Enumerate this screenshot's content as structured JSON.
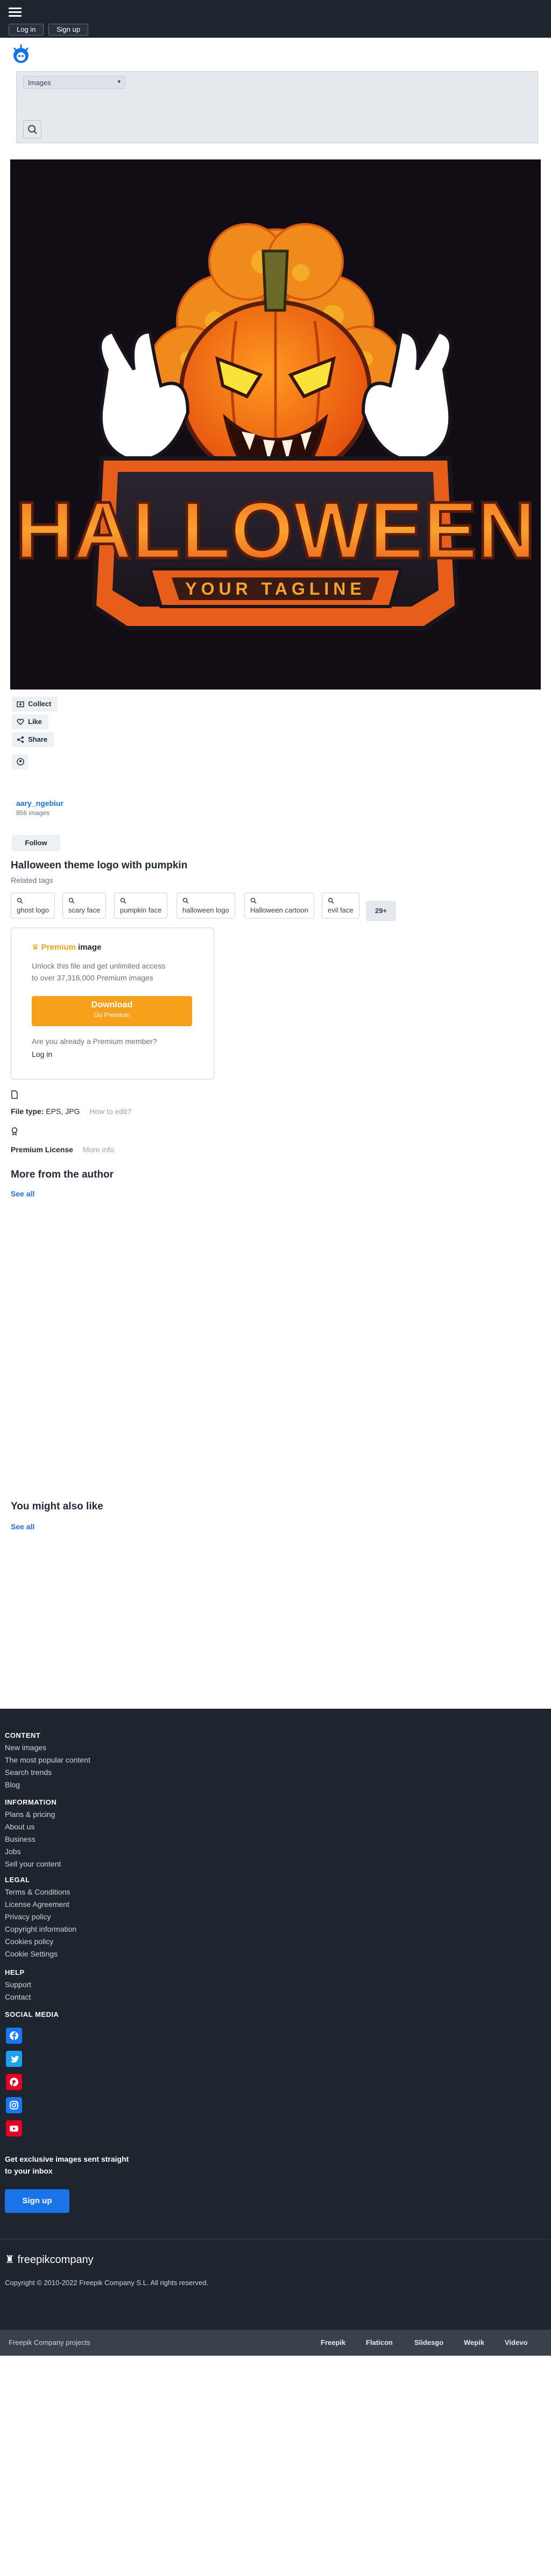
{
  "header": {
    "login_label": "Log in",
    "signup_label": "Sign up"
  },
  "search": {
    "category_selected": "Images"
  },
  "hero": {
    "artwork_title": "HALLOWEEN",
    "artwork_tagline": "YOUR TAGLINE"
  },
  "actions": {
    "collect": "Collect",
    "like": "Like",
    "share": "Share"
  },
  "author": {
    "name": "aary_ngebiur",
    "count": "856 images",
    "follow_label": "Follow"
  },
  "resource": {
    "title": "Halloween theme logo with pumpkin",
    "related_label": "Related tags",
    "tags": [
      "ghost logo",
      "scary face",
      "pumpkin face",
      "halloween logo",
      "Halloween cartoon",
      "evil face"
    ],
    "more_tags": "29+"
  },
  "premium": {
    "badge": "Premium",
    "badge_suffix": "image",
    "desc_line1": "Unlock this file and get unlimited access",
    "desc_line2": "to over 37,316,000 Premium images",
    "download_label": "Download",
    "go_premium": "Go Premium",
    "member_q": "Are you already a Premium member?",
    "login": "Log in"
  },
  "file_info": {
    "type_label": "File type:",
    "type_value": "EPS, JPG",
    "how_to_edit": "How to edit?",
    "license": "Premium License",
    "more_info": "More info"
  },
  "more_from_author": {
    "heading": "More from the author",
    "see_all": "See all"
  },
  "might_like": {
    "heading": "You might also like",
    "see_all": "See all"
  },
  "footer": {
    "content_h": "CONTENT",
    "content_links": [
      "New images",
      "The most popular content",
      "Search trends",
      "Blog"
    ],
    "info_h": "INFORMATION",
    "info_links": [
      "Plans & pricing",
      "About us",
      "Business",
      "Jobs",
      "Sell your content"
    ],
    "legal_h": "LEGAL",
    "legal_links": [
      "Terms & Conditions",
      "License Agreement",
      "Privacy policy",
      "Copyright information",
      "Cookies policy",
      "Cookie Settings"
    ],
    "help_h": "HELP",
    "help_links": [
      "Support",
      "Contact"
    ],
    "social_h": "SOCIAL MEDIA",
    "social_colors": {
      "facebook": "#1877f2",
      "twitter": "#1da1f2",
      "pinterest": "#e60023",
      "instagram": "#1877f2",
      "youtube": "#e60023"
    },
    "newsletter_line1": "Get exclusive images sent straight",
    "newsletter_line2": "to your inbox",
    "signup_label": "Sign up",
    "brand": "freepikcompany",
    "copyright": "Copyright © 2010-2022 Freepik Company S.L. All rights reserved."
  },
  "bottombar": {
    "projects_label": "Freepik Company projects",
    "links": [
      "Freepik",
      "Flaticon",
      "Slidesgo",
      "Wepik",
      "Videvo"
    ]
  },
  "colors": {
    "accent": "#1d6fd6",
    "premium": "#f7a01c",
    "dark_bg": "#1e252e"
  }
}
